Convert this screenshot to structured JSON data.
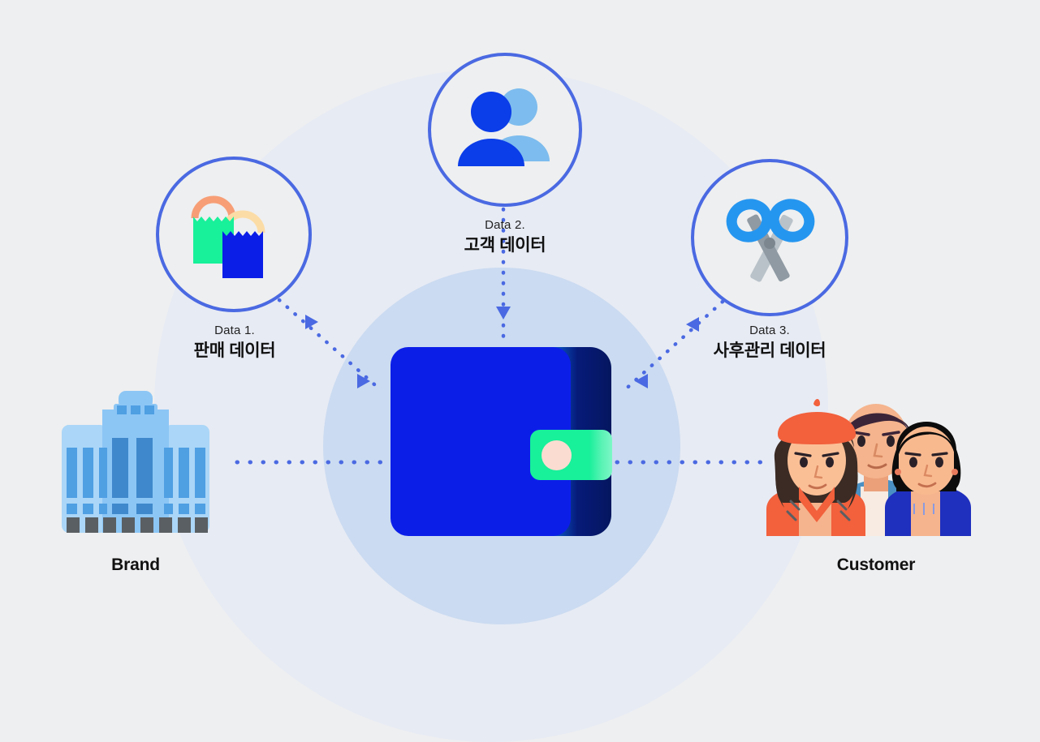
{
  "diagram": {
    "title_hidden": "",
    "background_color": "#eeeff0",
    "halo_outer_color": "#e4eaf6",
    "halo_inner_color": "#c6d8f0",
    "accent_blue": "#4a69e2",
    "brand_blue": "#0b1ee8",
    "accent_green": "#18f09a",
    "accent_peach": "#fbdcd0"
  },
  "center": {
    "icon": "wallet-icon",
    "label": ""
  },
  "endpoints": {
    "left": {
      "icon": "office-building-icon",
      "label": "Brand"
    },
    "right": {
      "icon": "customer-group-icon",
      "label": "Customer"
    }
  },
  "nodes": [
    {
      "eyebrow": "Data 1.",
      "title": "판매 데이터",
      "icon": "shopping-bags-icon",
      "border_color": "#4a69e2"
    },
    {
      "eyebrow": "Data 2.",
      "title": "고객 데이터",
      "icon": "people-icon",
      "border_color": "#4a69e2"
    },
    {
      "eyebrow": "Data 3.",
      "title": "사후관리 데이터",
      "icon": "scissors-icon",
      "border_color": "#4a69e2"
    }
  ],
  "connectors": {
    "style": "dotted",
    "color": "#4a69e2",
    "arrowheads": 5
  }
}
